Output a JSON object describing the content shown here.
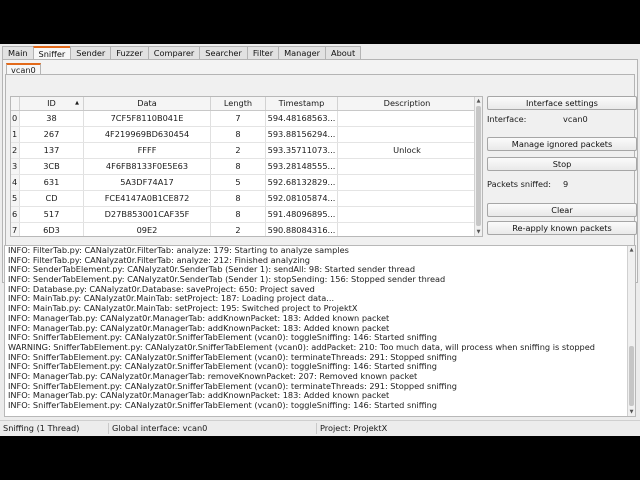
{
  "tabs": [
    "Main",
    "Sniffer",
    "Sender",
    "Fuzzer",
    "Comparer",
    "Searcher",
    "Filter",
    "Manager",
    "About"
  ],
  "active_tab": "Sniffer",
  "sniffer_tab": "vcan0",
  "table": {
    "columns": [
      "ID",
      "Data",
      "Length",
      "Timestamp",
      "Description"
    ],
    "sort_indicator": "▲",
    "rows": [
      {
        "idx": "0",
        "id": "38",
        "data": "7CF5F8110B041E",
        "length": "7",
        "timestamp": "594.48168563...",
        "description": ""
      },
      {
        "idx": "1",
        "id": "267",
        "data": "4F219969BD630454",
        "length": "8",
        "timestamp": "593.88156294...",
        "description": ""
      },
      {
        "idx": "2",
        "id": "137",
        "data": "FFFF",
        "length": "2",
        "timestamp": "593.35711073...",
        "description": "Unlock"
      },
      {
        "idx": "3",
        "id": "3CB",
        "data": "4F6FB8133F0E5E63",
        "length": "8",
        "timestamp": "593.28148555...",
        "description": ""
      },
      {
        "idx": "4",
        "id": "631",
        "data": "5A3DF74A17",
        "length": "5",
        "timestamp": "592.68132829...",
        "description": ""
      },
      {
        "idx": "5",
        "id": "CD",
        "data": "FCE4147A0B1CE872",
        "length": "8",
        "timestamp": "592.08105874...",
        "description": ""
      },
      {
        "idx": "6",
        "id": "517",
        "data": "D27B853001CAF35F",
        "length": "8",
        "timestamp": "591.48096895...",
        "description": ""
      },
      {
        "idx": "7",
        "id": "6D3",
        "data": "09E2",
        "length": "2",
        "timestamp": "590.88084316...",
        "description": ""
      }
    ]
  },
  "panel": {
    "interface_settings": "Interface settings",
    "interface_label": "Interface:",
    "interface_value": "vcan0",
    "manage_ignored": "Manage ignored packets",
    "stop": "Stop",
    "packets_label": "Packets sniffed:",
    "packets_value": "9",
    "clear": "Clear",
    "reapply": "Re-apply known packets"
  },
  "log": [
    "INFO: FilterTab.py: CANalyzat0r.FilterTab: analyze: 179: Starting to analyze samples",
    "INFO: FilterTab.py: CANalyzat0r.FilterTab: analyze: 212: Finished analyzing",
    "INFO: SenderTabElement.py: CANalyzat0r.SenderTab (Sender 1): sendAll: 98: Started sender thread",
    "INFO: SenderTabElement.py: CANalyzat0r.SenderTab (Sender 1): stopSending: 156: Stopped sender thread",
    "INFO: Database.py: CANalyzat0r.Database: saveProject: 650: Project saved",
    "INFO: MainTab.py: CANalyzat0r.MainTab: setProject: 187: Loading project data...",
    "INFO: MainTab.py: CANalyzat0r.MainTab: setProject: 195: Switched project to ProjektX",
    "INFO: ManagerTab.py: CANalyzat0r.ManagerTab: addKnownPacket: 183: Added known packet",
    "INFO: ManagerTab.py: CANalyzat0r.ManagerTab: addKnownPacket: 183: Added known packet",
    "INFO: SnifferTabElement.py: CANalyzat0r.SnifferTabElement (vcan0): toggleSniffing: 146: Started sniffing",
    "WARNING: SnifferTabElement.py: CANalyzat0r.SnifferTabElement (vcan0): addPacket: 210: Too much data, will process when sniffing is stopped",
    "INFO: SnifferTabElement.py: CANalyzat0r.SnifferTabElement (vcan0): terminateThreads: 291: Stopped sniffing",
    "INFO: SnifferTabElement.py: CANalyzat0r.SnifferTabElement (vcan0): toggleSniffing: 146: Started sniffing",
    "INFO: ManagerTab.py: CANalyzat0r.ManagerTab: removeKnownPacket: 207: Removed known packet",
    "INFO: SnifferTabElement.py: CANalyzat0r.SnifferTabElement (vcan0): terminateThreads: 291: Stopped sniffing",
    "INFO: ManagerTab.py: CANalyzat0r.ManagerTab: addKnownPacket: 183: Added known packet",
    "INFO: SnifferTabElement.py: CANalyzat0r.SnifferTabElement (vcan0): toggleSniffing: 146: Started sniffing"
  ],
  "status": {
    "state": "Sniffing (1 Thread)",
    "global_interface": "Global interface: vcan0",
    "project": "Project: ProjektX"
  },
  "colors": {
    "accent": "#e36a1a",
    "background": "#ececec"
  }
}
